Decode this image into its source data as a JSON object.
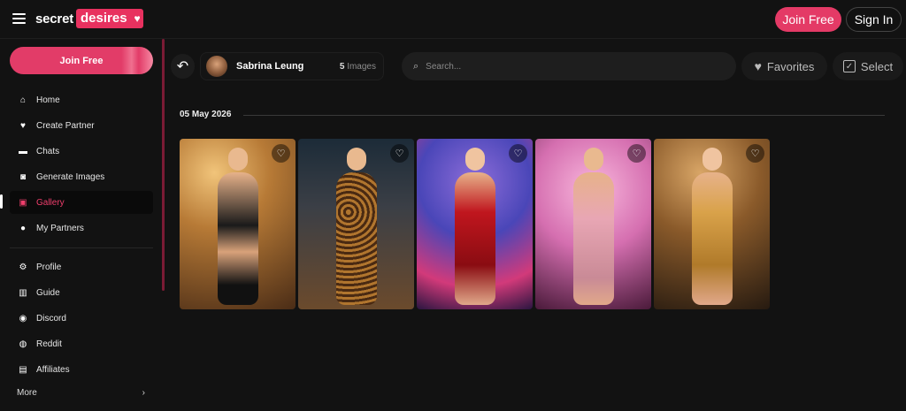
{
  "header": {
    "logo_part1": "secret",
    "logo_part2": "desires",
    "join_label": "Join Free",
    "signin_label": "Sign In"
  },
  "sidebar": {
    "join_label": "Join Free",
    "items": [
      {
        "label": "Home",
        "icon": "home-icon"
      },
      {
        "label": "Create Partner",
        "icon": "heart-shield-icon"
      },
      {
        "label": "Chats",
        "icon": "chat-icon"
      },
      {
        "label": "Generate Images",
        "icon": "camera-icon"
      },
      {
        "label": "Gallery",
        "icon": "gallery-icon",
        "active": true
      },
      {
        "label": "My Partners",
        "icon": "users-icon"
      }
    ],
    "items2": [
      {
        "label": "Profile",
        "icon": "gear-icon"
      },
      {
        "label": "Guide",
        "icon": "book-icon"
      },
      {
        "label": "Discord",
        "icon": "discord-icon"
      },
      {
        "label": "Reddit",
        "icon": "reddit-icon"
      },
      {
        "label": "Affiliates",
        "icon": "affiliate-icon"
      }
    ],
    "more_label": "More"
  },
  "toolbar": {
    "partner_name": "Sabrina Leung",
    "images_count": "5",
    "images_word": "Images",
    "search_placeholder": "Search...",
    "favorites_label": "Favorites",
    "select_label": "Select"
  },
  "gallery": {
    "date": "05 May 2026",
    "image_count": 5
  },
  "colors": {
    "accent": "#e43a66",
    "background": "#121212"
  }
}
